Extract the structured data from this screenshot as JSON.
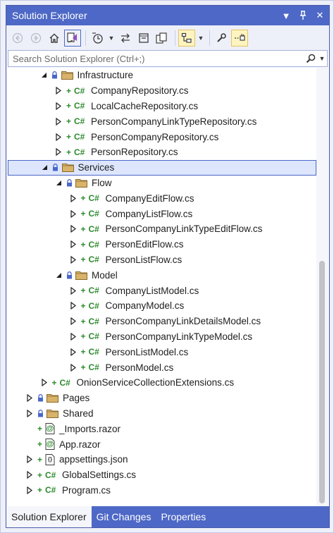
{
  "window": {
    "title": "Solution Explorer",
    "title_buttons": [
      {
        "icon": "dropdown-arrow-icon",
        "glyph": "▼"
      },
      {
        "icon": "pin-icon",
        "glyph": "⊣"
      },
      {
        "icon": "close-icon",
        "glyph": "✕"
      }
    ]
  },
  "colors": {
    "title_bg": "#4d68c6",
    "selected_bg": "#dde6fd",
    "selected_border": "#4a67c8",
    "csharp_green": "#2d8a2d",
    "folder_tan": "#d9b36a",
    "lock_blue": "#4a67c8"
  },
  "toolbar": {
    "items": [
      "back-icon",
      "forward-icon",
      "home-icon",
      "switch-views-icon",
      "pending-changes-filter-icon",
      "sync-with-active-document-icon",
      "collapse-all-icon",
      "show-all-files-icon",
      "class-view-icon",
      "properties-icon",
      "preview-selected-items-icon"
    ]
  },
  "search": {
    "placeholder": "Search Solution Explorer (Ctrl+;)"
  },
  "tree": [
    {
      "depth": 3,
      "expander": "open",
      "lock": true,
      "icon": "folder",
      "label": "Infrastructure"
    },
    {
      "depth": 4,
      "expander": "closed",
      "plus": true,
      "icon": "cs",
      "label": "CompanyRepository.cs"
    },
    {
      "depth": 4,
      "expander": "closed",
      "plus": true,
      "icon": "cs",
      "label": "LocalCacheRepository.cs"
    },
    {
      "depth": 4,
      "expander": "closed",
      "plus": true,
      "icon": "cs",
      "label": "PersonCompanyLinkTypeRepository.cs"
    },
    {
      "depth": 4,
      "expander": "closed",
      "plus": true,
      "icon": "cs",
      "label": "PersonCompanyRepository.cs"
    },
    {
      "depth": 4,
      "expander": "closed",
      "plus": true,
      "icon": "cs",
      "label": "PersonRepository.cs"
    },
    {
      "depth": 3,
      "expander": "open",
      "lock": true,
      "icon": "folder",
      "label": "Services",
      "selected": true
    },
    {
      "depth": 4,
      "expander": "open",
      "lock": true,
      "icon": "folder",
      "label": "Flow"
    },
    {
      "depth": 5,
      "expander": "closed",
      "plus": true,
      "icon": "cs",
      "label": "CompanyEditFlow.cs"
    },
    {
      "depth": 5,
      "expander": "closed",
      "plus": true,
      "icon": "cs",
      "label": "CompanyListFlow.cs"
    },
    {
      "depth": 5,
      "expander": "closed",
      "plus": true,
      "icon": "cs",
      "label": "PersonCompanyLinkTypeEditFlow.cs"
    },
    {
      "depth": 5,
      "expander": "closed",
      "plus": true,
      "icon": "cs",
      "label": "PersonEditFlow.cs"
    },
    {
      "depth": 5,
      "expander": "closed",
      "plus": true,
      "icon": "cs",
      "label": "PersonListFlow.cs"
    },
    {
      "depth": 4,
      "expander": "open",
      "lock": true,
      "icon": "folder",
      "label": "Model"
    },
    {
      "depth": 5,
      "expander": "closed",
      "plus": true,
      "icon": "cs",
      "label": "CompanyListModel.cs"
    },
    {
      "depth": 5,
      "expander": "closed",
      "plus": true,
      "icon": "cs",
      "label": "CompanyModel.cs"
    },
    {
      "depth": 5,
      "expander": "closed",
      "plus": true,
      "icon": "cs",
      "label": "PersonCompanyLinkDetailsModel.cs"
    },
    {
      "depth": 5,
      "expander": "closed",
      "plus": true,
      "icon": "cs",
      "label": "PersonCompanyLinkTypeModel.cs"
    },
    {
      "depth": 5,
      "expander": "closed",
      "plus": true,
      "icon": "cs",
      "label": "PersonListModel.cs"
    },
    {
      "depth": 5,
      "expander": "closed",
      "plus": true,
      "icon": "cs",
      "label": "PersonModel.cs"
    },
    {
      "depth": 3,
      "expander": "closed",
      "plus": true,
      "icon": "cs",
      "label": "OnionServiceCollectionExtensions.cs"
    },
    {
      "depth": 2,
      "expander": "closed",
      "lock": true,
      "icon": "folder",
      "label": "Pages"
    },
    {
      "depth": 2,
      "expander": "closed",
      "lock": true,
      "icon": "folder",
      "label": "Shared"
    },
    {
      "depth": 2,
      "expander": "none",
      "plus": true,
      "icon": "razor",
      "label": "_Imports.razor"
    },
    {
      "depth": 2,
      "expander": "none",
      "plus": true,
      "icon": "razor",
      "label": "App.razor"
    },
    {
      "depth": 2,
      "expander": "closed",
      "plus": true,
      "icon": "json",
      "label": "appsettings.json"
    },
    {
      "depth": 2,
      "expander": "closed",
      "plus": true,
      "icon": "cs",
      "label": "GlobalSettings.cs"
    },
    {
      "depth": 2,
      "expander": "closed",
      "plus": true,
      "icon": "cs",
      "label": "Program.cs"
    }
  ],
  "icon_text": {
    "cs": "C#",
    "json": "{}",
    "razor": "@"
  },
  "tabs": [
    {
      "label": "Solution Explorer",
      "active": true
    },
    {
      "label": "Git Changes",
      "active": false
    },
    {
      "label": "Properties",
      "active": false
    }
  ]
}
